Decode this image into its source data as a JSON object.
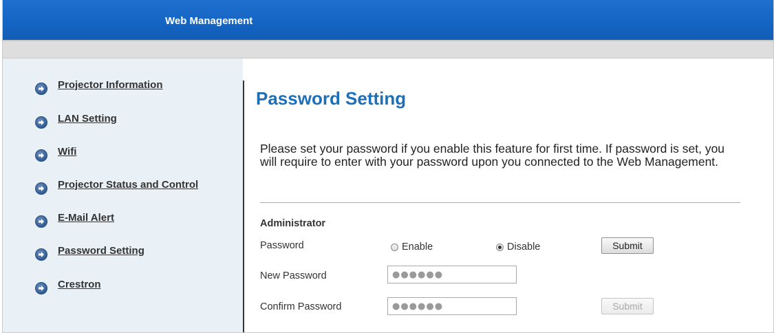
{
  "header": {
    "title": "Web Management"
  },
  "sidebar": {
    "items": [
      {
        "label": "Projector Information"
      },
      {
        "label": "LAN Setting"
      },
      {
        "label": "Wifi"
      },
      {
        "label": "Projector Status and Control"
      },
      {
        "label": "E-Mail Alert"
      },
      {
        "label": "Password Setting"
      },
      {
        "label": "Crestron"
      }
    ],
    "icon": "arrow-circle-right-icon"
  },
  "main": {
    "title": "Password Setting",
    "description": "Please set your password if you enable this feature for first time. If password is set, you will require to enter with your password upon you connected to the Web Management.",
    "section_label": "Administrator",
    "password_row": {
      "label": "Password",
      "enable_label": "Enable",
      "disable_label": "Disable",
      "selected": "Disable",
      "submit_label": "Submit"
    },
    "new_password": {
      "label": "New Password",
      "value": "●●●●●●"
    },
    "confirm_password": {
      "label": "Confirm Password",
      "value": "●●●●●●",
      "submit_label": "Submit"
    }
  },
  "colors": {
    "header_blue": "#1464c2",
    "title_blue": "#1d6fb8",
    "sidebar_bg": "#e9f0f6"
  }
}
